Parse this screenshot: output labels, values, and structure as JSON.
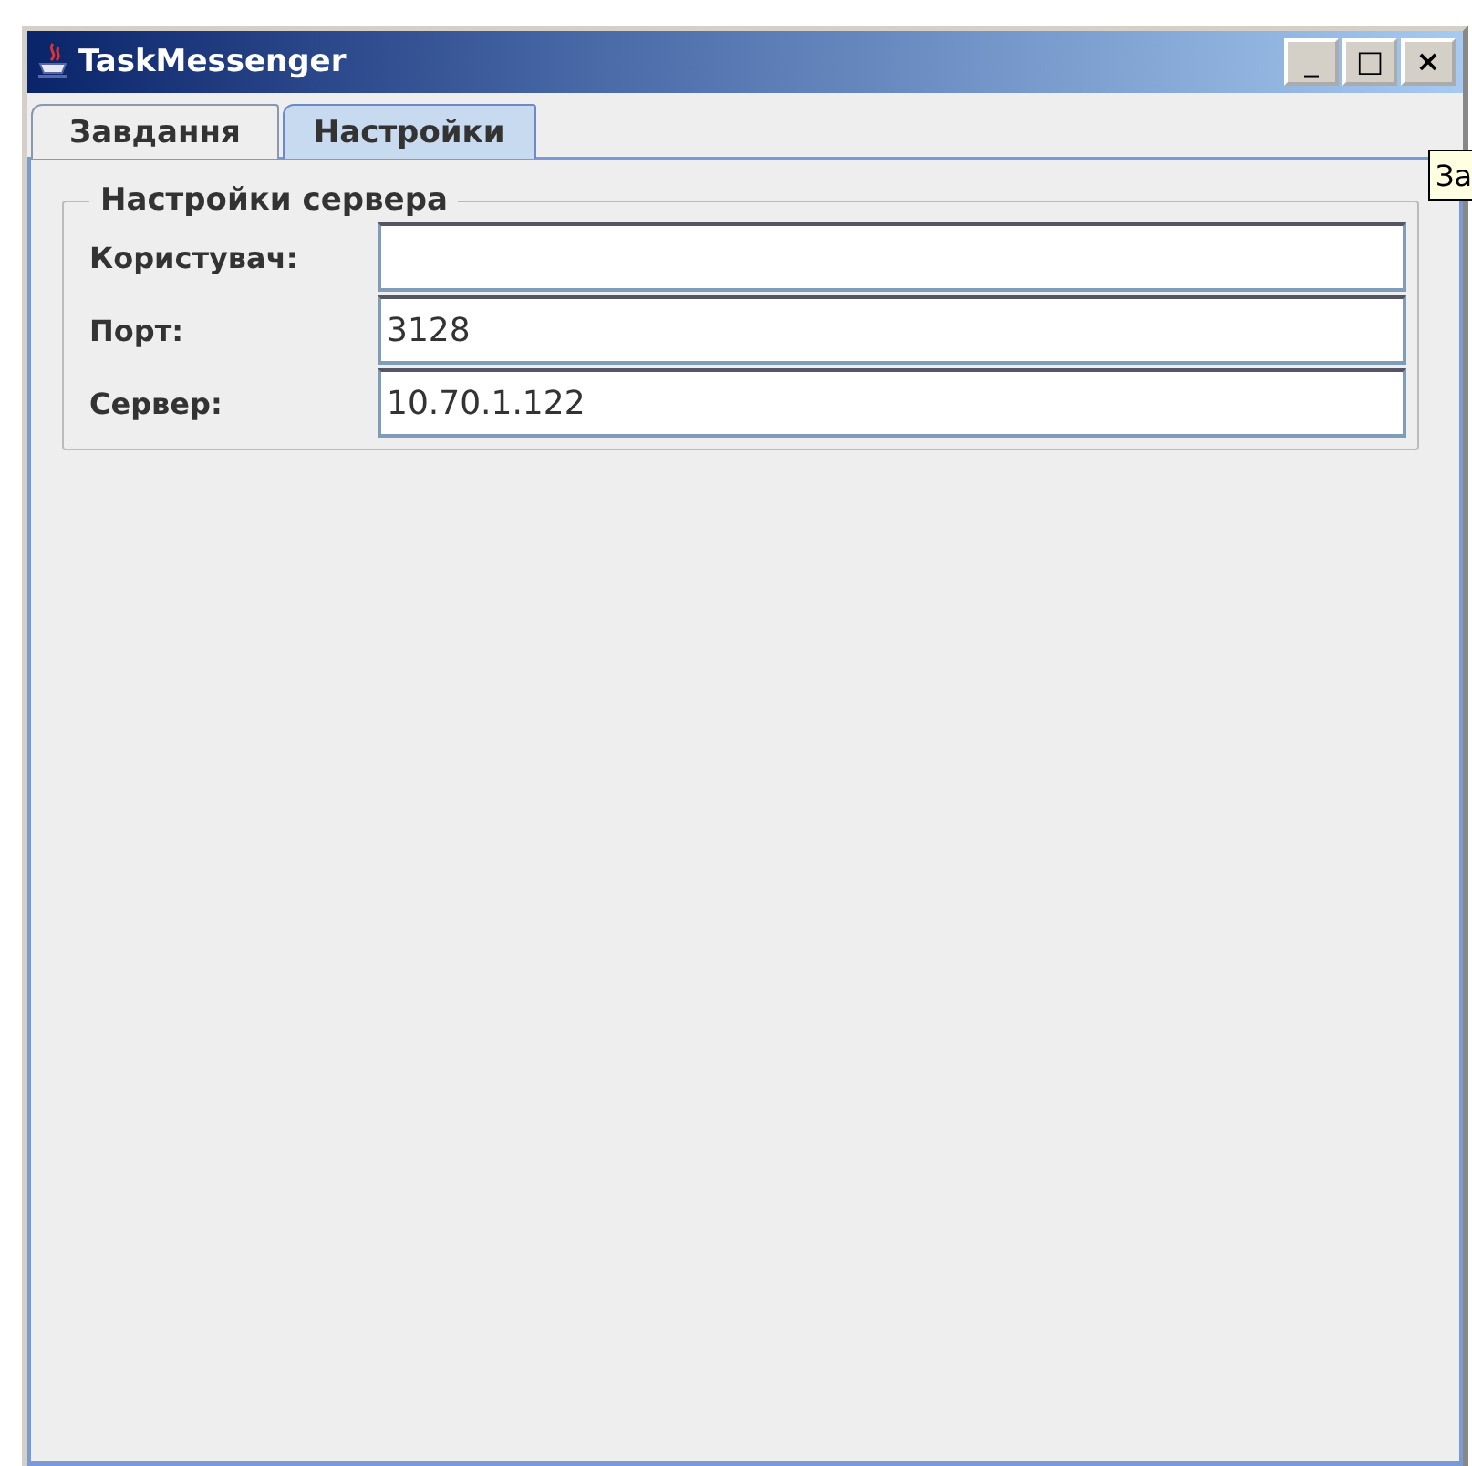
{
  "window": {
    "title": "TaskMessenger"
  },
  "title_buttons": [
    "_",
    "□",
    "×"
  ],
  "tabs": [
    {
      "label": "Завдання",
      "selected": false
    },
    {
      "label": "Настройки",
      "selected": true
    }
  ],
  "tooltip": {
    "text": "За"
  },
  "group": {
    "title": "Настройки сервера",
    "fields": [
      {
        "label": "Користувач:"
      },
      {
        "label": "Порт:",
        "value": "3128"
      },
      {
        "label": "Сервер:",
        "value": "10.70.1.122"
      }
    ]
  }
}
